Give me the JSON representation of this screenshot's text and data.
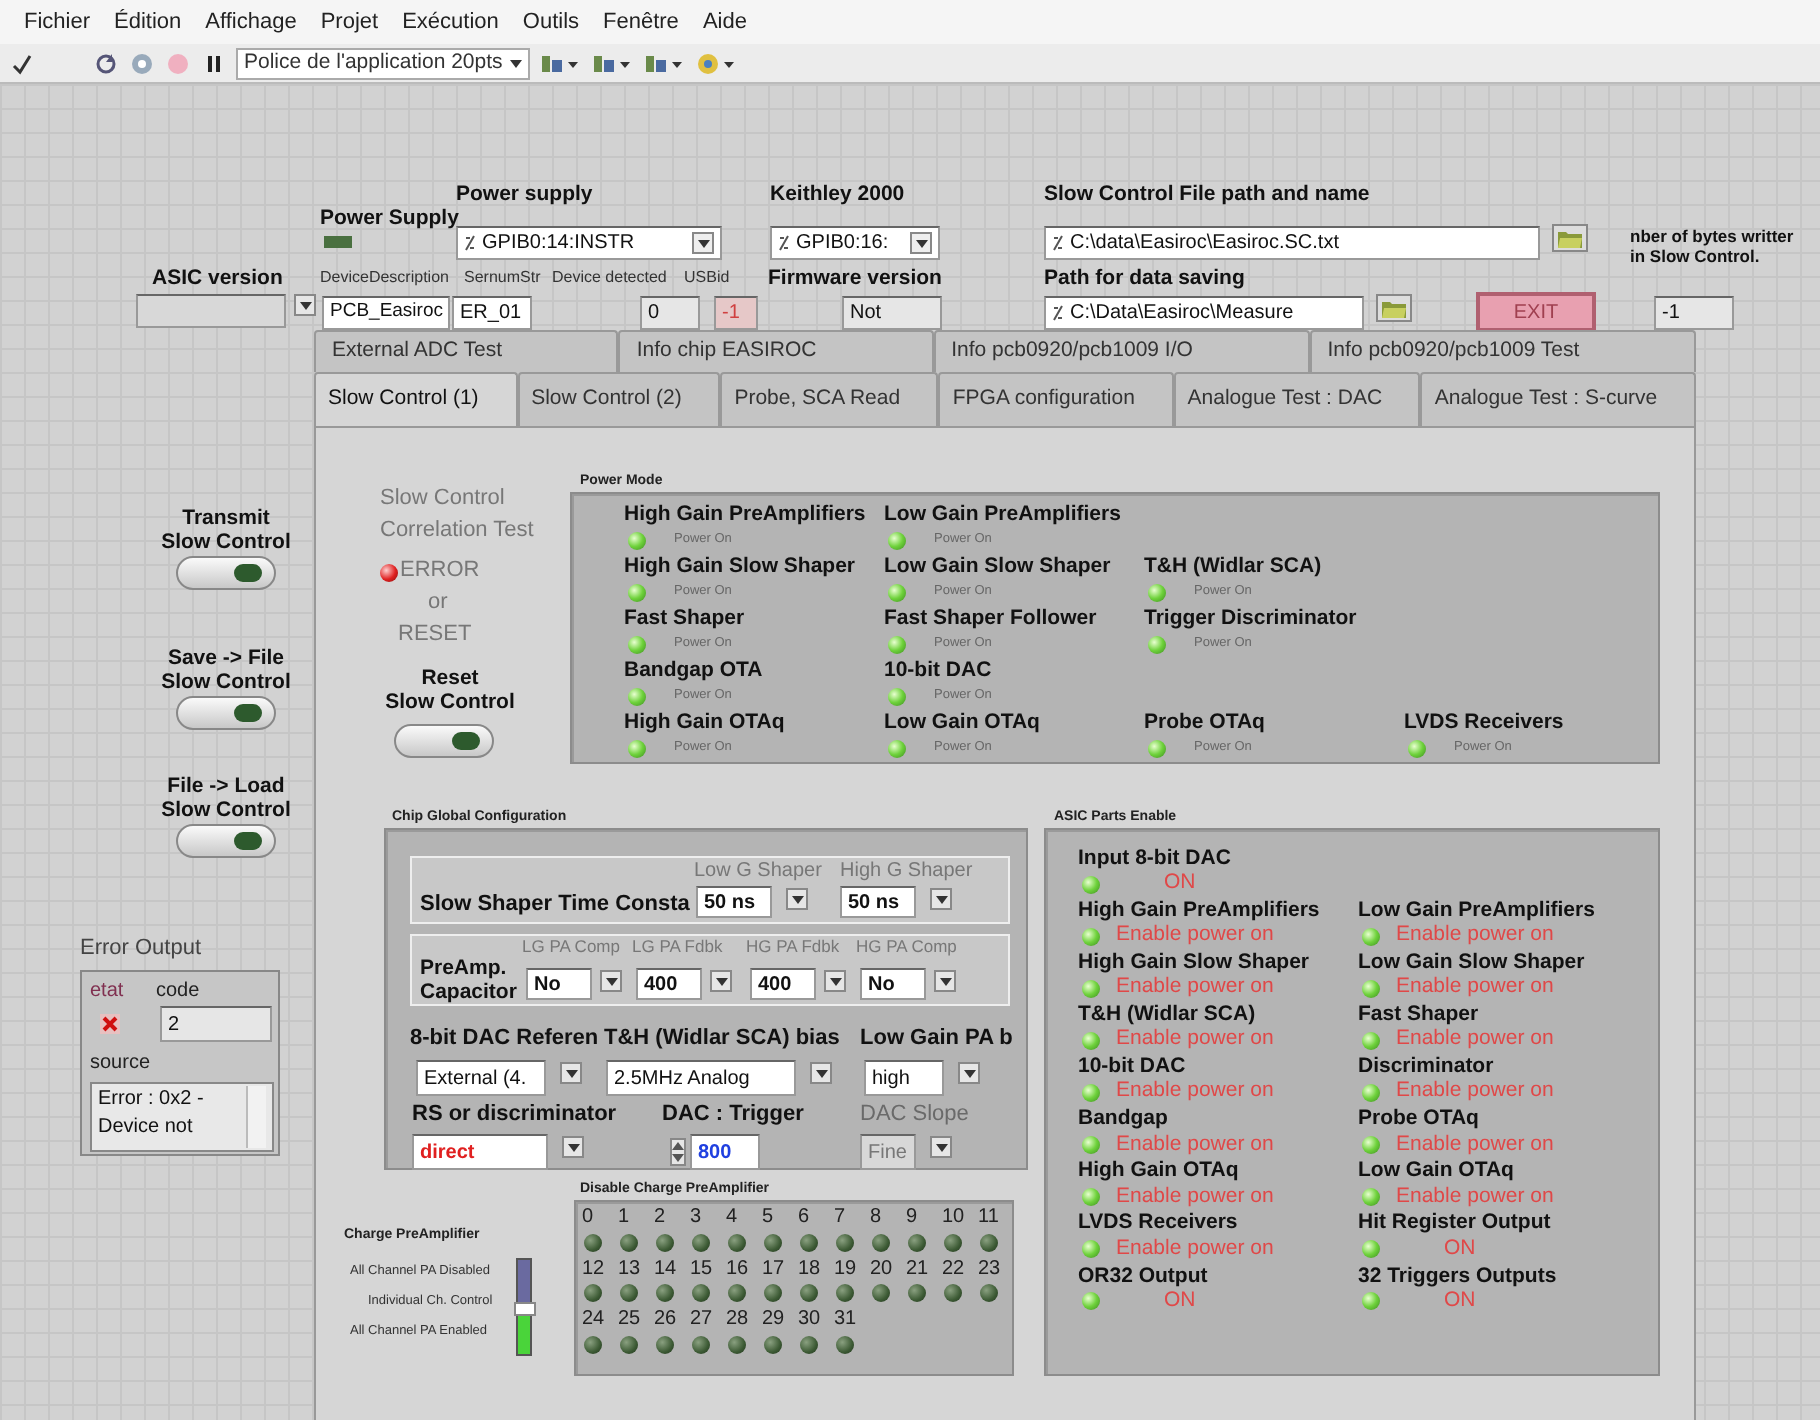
{
  "menu": [
    "Fichier",
    "Édition",
    "Affichage",
    "Projet",
    "Exécution",
    "Outils",
    "Fenêtre",
    "Aide"
  ],
  "toolbar": {
    "font_menu": "Police de l'application 20pts"
  },
  "header": {
    "power_led_label": "Power Supply",
    "power_supply": {
      "label": "Power supply",
      "value": "GPIB0:14:INSTR"
    },
    "keithley": {
      "label": "Keithley 2000",
      "value": "GPIB0:16:"
    },
    "sc_file": {
      "label": "Slow Control File path and name",
      "value": "C:\\data\\Easiroc\\Easiroc.SC.txt"
    },
    "bytes_written": {
      "label": "nber of bytes writter\nin Slow Control.",
      "value": "-1"
    },
    "asic_version": {
      "label": "ASIC version"
    },
    "device_description": {
      "label": "DeviceDescription",
      "value": "PCB_Easiroc"
    },
    "sernum": {
      "label": "SernumStr",
      "value": "ER_01"
    },
    "device_detected": {
      "label": "Device detected",
      "value": "0"
    },
    "usbid": {
      "label": "USBid",
      "value": "-1"
    },
    "firmware": {
      "label": "Firmware version",
      "value": "Not"
    },
    "data_path": {
      "label": "Path for data saving",
      "value": "C:\\Data\\Easiroc\\Measure"
    },
    "exit_button": "EXIT"
  },
  "side_buttons": [
    {
      "label": "Transmit\nSlow Control",
      "on": false
    },
    {
      "label": "Save -> File\nSlow Control",
      "on": false
    },
    {
      "label": "File -> Load\nSlow Control",
      "on": false
    }
  ],
  "error_output": {
    "label": "Error Output",
    "status_label": "etat",
    "error": true,
    "code_label": "code",
    "code": "2",
    "source_label": "source",
    "source": "Error : 0x2 -\nDevice not"
  },
  "tab_rows": [
    [
      {
        "label": "External ADC Test",
        "selected": false
      },
      {
        "label": "Info chip EASIROC",
        "selected": false
      },
      {
        "label": "Info pcb0920/pcb1009 I/O",
        "selected": false
      },
      {
        "label": "Info pcb0920/pcb1009 Test",
        "selected": false
      }
    ],
    [
      {
        "label": "Slow Control (1)",
        "selected": true
      },
      {
        "label": "Slow Control (2)",
        "selected": false
      },
      {
        "label": "Probe, SCA Read",
        "selected": false
      },
      {
        "label": "FPGA configuration",
        "selected": false
      },
      {
        "label": "Analogue Test : DAC",
        "selected": false
      },
      {
        "label": "Analogue Test : S-curve",
        "selected": false
      }
    ]
  ],
  "correlation": {
    "title": "Slow Control\nCorrelation Test",
    "error_on": true,
    "error_label": "ERROR",
    "or_label": "or",
    "reset_label": "RESET",
    "reset_button_label": "Reset\nSlow Control",
    "reset_on": false
  },
  "power_mode": {
    "title": "Power Mode",
    "rows": [
      [
        {
          "label": "High Gain PreAmplifiers",
          "on": true,
          "state_text": "Power On"
        },
        {
          "label": "Low Gain PreAmplifiers",
          "on": true,
          "state_text": "Power On"
        }
      ],
      [
        {
          "label": "High Gain Slow Shaper",
          "on": true,
          "state_text": "Power On"
        },
        {
          "label": "Low Gain Slow Shaper",
          "on": true,
          "state_text": "Power On"
        },
        {
          "label": "T&H (Widlar SCA)",
          "on": true,
          "state_text": "Power On"
        }
      ],
      [
        {
          "label": "Fast Shaper",
          "on": true,
          "state_text": "Power On"
        },
        {
          "label": "Fast Shaper Follower",
          "on": true,
          "state_text": "Power On"
        },
        {
          "label": "Trigger Discriminator",
          "on": true,
          "state_text": "Power On"
        }
      ],
      [
        {
          "label": "Bandgap OTA",
          "on": true,
          "state_text": "Power On"
        },
        {
          "label": "10-bit DAC",
          "on": true,
          "state_text": "Power On"
        }
      ],
      [
        {
          "label": "High Gain OTAq",
          "on": true,
          "state_text": "Power On"
        },
        {
          "label": "Low Gain OTAq",
          "on": true,
          "state_text": "Power On"
        },
        {
          "label": "Probe OTAq",
          "on": true,
          "state_text": "Power On"
        },
        {
          "label": "LVDS Receivers",
          "on": true,
          "state_text": "Power On"
        }
      ]
    ]
  },
  "chip_config": {
    "title": "Chip Global Configuration",
    "shaper": {
      "label": "Slow Shaper Time Consta",
      "fields": [
        {
          "label": "Low G Shaper",
          "value": "50 ns"
        },
        {
          "label": "High G Shaper",
          "value": "50 ns"
        }
      ]
    },
    "preamp": {
      "label": "PreAmp.\nCapacitor",
      "fields": [
        {
          "label": "LG PA Comp",
          "value": "No"
        },
        {
          "label": "LG PA Fdbk",
          "value": "400"
        },
        {
          "label": "HG PA Fdbk",
          "value": "400"
        },
        {
          "label": "HG PA Comp",
          "value": "No"
        }
      ]
    },
    "selectors": [
      {
        "label": "8-bit DAC Referen",
        "value": "External (4.",
        "kind": "ring",
        "disabled": false
      },
      {
        "label": "T&H (Widlar SCA) bias",
        "value": "2.5MHz Analog",
        "kind": "ring",
        "disabled": false
      },
      {
        "label": "Low Gain PA b",
        "value": "high",
        "kind": "ring",
        "disabled": false
      },
      {
        "label": "RS or discriminator",
        "value": "direct",
        "kind": "ring",
        "disabled": false,
        "color": "#e02020"
      },
      {
        "label": "DAC : Trigger",
        "value": "800",
        "kind": "numeric",
        "disabled": false,
        "color": "#2040e0"
      },
      {
        "label": "DAC Slope",
        "value": "Fine",
        "kind": "ring",
        "disabled": true
      }
    ]
  },
  "charge_preamp": {
    "title": "Charge PreAmplifier",
    "positions": [
      "All Channel PA Disabled",
      "Individual Ch. Control",
      "All Channel PA Enabled"
    ],
    "level": 0.5
  },
  "disable_preamp": {
    "title": "Disable Charge PreAmplifier",
    "channels": [
      {
        "label": "0",
        "on": false
      },
      {
        "label": "1",
        "on": false
      },
      {
        "label": "2",
        "on": false
      },
      {
        "label": "3",
        "on": false
      },
      {
        "label": "4",
        "on": false
      },
      {
        "label": "5",
        "on": false
      },
      {
        "label": "6",
        "on": false
      },
      {
        "label": "7",
        "on": false
      },
      {
        "label": "8",
        "on": false
      },
      {
        "label": "9",
        "on": false
      },
      {
        "label": "10",
        "on": false
      },
      {
        "label": "11",
        "on": false
      },
      {
        "label": "12",
        "on": false
      },
      {
        "label": "13",
        "on": false
      },
      {
        "label": "14",
        "on": false
      },
      {
        "label": "15",
        "on": false
      },
      {
        "label": "16",
        "on": false
      },
      {
        "label": "17",
        "on": false
      },
      {
        "label": "18",
        "on": false
      },
      {
        "label": "19",
        "on": false
      },
      {
        "label": "20",
        "on": false
      },
      {
        "label": "21",
        "on": false
      },
      {
        "label": "22",
        "on": false
      },
      {
        "label": "23",
        "on": false
      },
      {
        "label": "24",
        "on": false
      },
      {
        "label": "25",
        "on": false
      },
      {
        "label": "26",
        "on": false
      },
      {
        "label": "27",
        "on": false
      },
      {
        "label": "28",
        "on": false
      },
      {
        "label": "29",
        "on": false
      },
      {
        "label": "30",
        "on": false
      },
      {
        "label": "31",
        "on": false
      }
    ]
  },
  "asic_parts": {
    "title": "ASIC Parts Enable",
    "rows": [
      [
        {
          "label": "Input 8-bit DAC",
          "on": true,
          "state_text": "ON"
        }
      ],
      [
        {
          "label": "High Gain PreAmplifiers",
          "on": true,
          "state_text": "Enable power on"
        },
        {
          "label": "Low Gain PreAmplifiers",
          "on": true,
          "state_text": "Enable power on"
        }
      ],
      [
        {
          "label": "High Gain Slow Shaper",
          "on": true,
          "state_text": "Enable power on"
        },
        {
          "label": "Low Gain Slow Shaper",
          "on": true,
          "state_text": "Enable power on"
        }
      ],
      [
        {
          "label": "T&H (Widlar SCA)",
          "on": true,
          "state_text": "Enable power on"
        },
        {
          "label": "Fast Shaper",
          "on": true,
          "state_text": "Enable power on"
        }
      ],
      [
        {
          "label": "10-bit DAC",
          "on": true,
          "state_text": "Enable power on"
        },
        {
          "label": "Discriminator",
          "on": true,
          "state_text": "Enable power on"
        }
      ],
      [
        {
          "label": "Bandgap",
          "on": true,
          "state_text": "Enable power on"
        },
        {
          "label": "Probe OTAq",
          "on": true,
          "state_text": "Enable power on"
        }
      ],
      [
        {
          "label": "High Gain OTAq",
          "on": true,
          "state_text": "Enable power on"
        },
        {
          "label": "Low Gain OTAq",
          "on": true,
          "state_text": "Enable power on"
        }
      ],
      [
        {
          "label": "LVDS Receivers",
          "on": true,
          "state_text": "Enable power on"
        },
        {
          "label": "Hit Register Output",
          "on": true,
          "state_text": "ON"
        }
      ],
      [
        {
          "label": "OR32 Output",
          "on": true,
          "state_text": "ON"
        },
        {
          "label": "32 Triggers Outputs",
          "on": true,
          "state_text": "ON"
        }
      ]
    ]
  }
}
